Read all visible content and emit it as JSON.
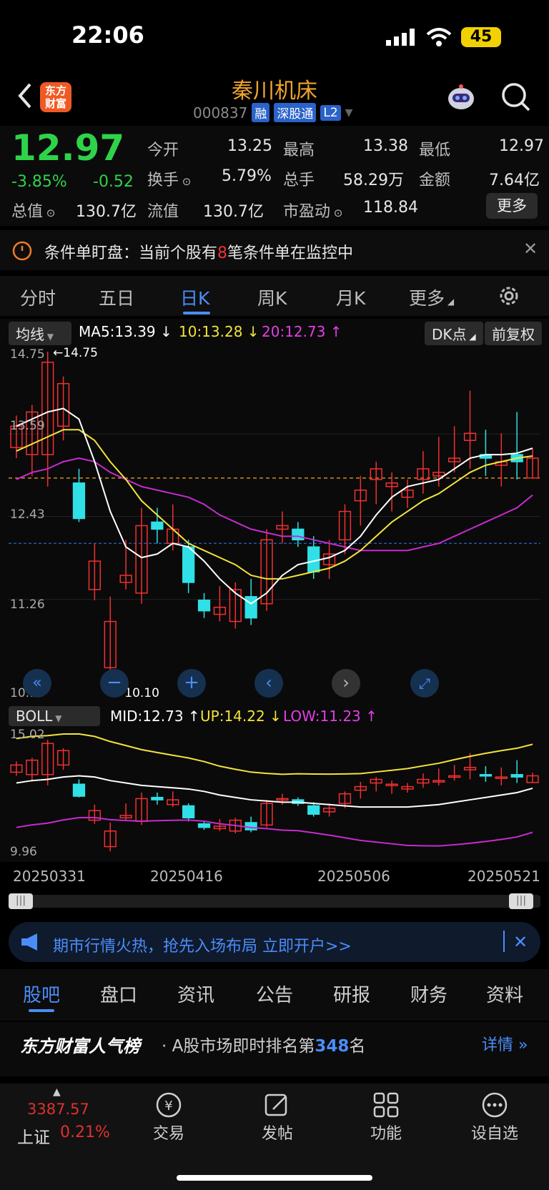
{
  "status": {
    "time": "22:06",
    "battery": "45"
  },
  "header": {
    "logo": "东方\n财富",
    "stock_name": "秦川机床",
    "stock_code": "000837",
    "tags": [
      "融",
      "深股通",
      "L2"
    ]
  },
  "quote": {
    "price": "12.97",
    "change_pct": "-3.85%",
    "change": "-0.52",
    "fields": [
      {
        "label": "今开",
        "value": "13.25"
      },
      {
        "label": "最高",
        "value": "13.38"
      },
      {
        "label": "最低",
        "value": "12.97"
      },
      {
        "label": "换手",
        "value": "5.79%"
      },
      {
        "label": "总手",
        "value": "58.29万"
      },
      {
        "label": "金额",
        "value": "7.64亿"
      },
      {
        "label": "总值",
        "value": "130.7亿"
      },
      {
        "label": "流值",
        "value": "130.7亿"
      },
      {
        "label": "市盈动",
        "value": "118.84"
      }
    ],
    "more_label": "更多"
  },
  "condition_bar": {
    "text_prefix": "条件单盯盘：当前个股有",
    "count": "8",
    "text_suffix": "笔条件单在监控中"
  },
  "period_tabs": [
    "分时",
    "五日",
    "日K",
    "周K",
    "月K",
    "更多"
  ],
  "ma_bar": {
    "selector": "均线",
    "ma5": "MA5:13.39",
    "ma10": "10:13.28",
    "ma20": "20:12.73",
    "dk_label": "DK点",
    "adj_label": "前复权"
  },
  "chart_data": {
    "type": "candlestick",
    "y_labels": [
      "14.75",
      "13.59",
      "12.43",
      "11.26",
      "10.10"
    ],
    "ylim": [
      10.1,
      14.75
    ],
    "high_marker": "14.75",
    "low_marker": "10.10",
    "candles": [
      {
        "o": 13.4,
        "c": 13.7,
        "h": 13.85,
        "l": 13.25
      },
      {
        "o": 13.3,
        "c": 13.9,
        "h": 14.0,
        "l": 13.0
      },
      {
        "o": 13.3,
        "c": 14.6,
        "h": 14.75,
        "l": 12.85
      },
      {
        "o": 13.7,
        "c": 14.3,
        "h": 14.4,
        "l": 13.5
      },
      {
        "o": 12.9,
        "c": 12.4,
        "h": 13.1,
        "l": 12.35
      },
      {
        "o": 11.4,
        "c": 11.8,
        "h": 12.05,
        "l": 11.25
      },
      {
        "o": 10.3,
        "c": 10.95,
        "h": 11.3,
        "l": 10.1
      },
      {
        "o": 11.5,
        "c": 11.6,
        "h": 12.1,
        "l": 11.4
      },
      {
        "o": 11.35,
        "c": 12.3,
        "h": 12.55,
        "l": 11.2
      },
      {
        "o": 12.35,
        "c": 12.25,
        "h": 12.55,
        "l": 12.05
      },
      {
        "o": 12.05,
        "c": 12.25,
        "h": 12.6,
        "l": 11.95
      },
      {
        "o": 12.0,
        "c": 11.5,
        "h": 12.1,
        "l": 11.35
      },
      {
        "o": 11.25,
        "c": 11.1,
        "h": 11.35,
        "l": 11.0
      },
      {
        "o": 11.05,
        "c": 11.15,
        "h": 11.45,
        "l": 10.95
      },
      {
        "o": 10.95,
        "c": 11.4,
        "h": 11.5,
        "l": 10.85
      },
      {
        "o": 11.3,
        "c": 11.0,
        "h": 11.55,
        "l": 10.9
      },
      {
        "o": 11.2,
        "c": 12.1,
        "h": 12.25,
        "l": 11.1
      },
      {
        "o": 12.25,
        "c": 12.3,
        "h": 12.5,
        "l": 12.05
      },
      {
        "o": 12.25,
        "c": 12.1,
        "h": 12.35,
        "l": 12.0
      },
      {
        "o": 12.0,
        "c": 11.65,
        "h": 12.15,
        "l": 11.55
      },
      {
        "o": 11.75,
        "c": 11.9,
        "h": 12.1,
        "l": 11.55
      },
      {
        "o": 12.1,
        "c": 12.5,
        "h": 12.6,
        "l": 11.9
      },
      {
        "o": 12.65,
        "c": 12.8,
        "h": 13.0,
        "l": 12.3
      },
      {
        "o": 12.95,
        "c": 13.1,
        "h": 13.2,
        "l": 12.6
      },
      {
        "o": 12.85,
        "c": 12.9,
        "h": 13.05,
        "l": 12.5
      },
      {
        "o": 12.7,
        "c": 12.8,
        "h": 12.95,
        "l": 12.55
      },
      {
        "o": 12.95,
        "c": 13.1,
        "h": 13.35,
        "l": 12.75
      },
      {
        "o": 13.0,
        "c": 13.05,
        "h": 13.55,
        "l": 12.85
      },
      {
        "o": 13.2,
        "c": 13.25,
        "h": 13.7,
        "l": 13.05
      },
      {
        "o": 13.5,
        "c": 13.6,
        "h": 14.2,
        "l": 13.1
      },
      {
        "o": 13.3,
        "c": 13.25,
        "h": 13.65,
        "l": 13.0
      },
      {
        "o": 13.15,
        "c": 13.2,
        "h": 13.6,
        "l": 12.85
      },
      {
        "o": 13.3,
        "c": 13.2,
        "h": 13.9,
        "l": 12.95
      },
      {
        "o": 12.97,
        "c": 13.25,
        "h": 13.38,
        "l": 12.97
      }
    ],
    "ma5": [
      13.7,
      13.8,
      13.9,
      13.95,
      13.8,
      13.2,
      12.5,
      12.0,
      11.85,
      11.9,
      12.05,
      12.0,
      11.8,
      11.55,
      11.35,
      11.2,
      11.35,
      11.6,
      11.75,
      11.8,
      11.85,
      11.95,
      12.15,
      12.45,
      12.7,
      12.85,
      12.9,
      12.95,
      13.1,
      13.25,
      13.3,
      13.3,
      13.32,
      13.39
    ],
    "ma10": [
      13.35,
      13.45,
      13.55,
      13.65,
      13.65,
      13.5,
      13.2,
      12.95,
      12.65,
      12.45,
      12.25,
      12.05,
      11.95,
      11.85,
      11.75,
      11.6,
      11.55,
      11.55,
      11.6,
      11.65,
      11.7,
      11.8,
      11.95,
      12.15,
      12.35,
      12.5,
      12.65,
      12.75,
      12.9,
      13.05,
      13.15,
      13.2,
      13.25,
      13.28
    ],
    "ma20": [
      12.95,
      13.05,
      13.1,
      13.2,
      13.25,
      13.2,
      13.05,
      12.95,
      12.85,
      12.8,
      12.75,
      12.7,
      12.6,
      12.45,
      12.35,
      12.25,
      12.2,
      12.15,
      12.15,
      12.1,
      12.05,
      12.0,
      11.95,
      11.95,
      11.95,
      11.95,
      12.0,
      12.05,
      12.15,
      12.25,
      12.35,
      12.45,
      12.55,
      12.73
    ],
    "boll": {
      "selector": "BOLL",
      "mid": "MID:12.73",
      "up": "UP:14.22",
      "low": "LOW:11.23",
      "y_labels": [
        "15.02",
        "9.96"
      ]
    },
    "x_labels": [
      "20250331",
      "20250416",
      "20250506",
      "20250521"
    ]
  },
  "banner": {
    "text": "期市行情火热，抢先入场布局 立即开户>>"
  },
  "bottom_tabs": [
    "股吧",
    "盘口",
    "资讯",
    "公告",
    "研报",
    "财务",
    "资料"
  ],
  "rank": {
    "brand": "东方财富人气榜",
    "text_prefix": "· A股市场即时排名第",
    "rank": "348",
    "text_suffix": "名",
    "detail": "详情"
  },
  "bottom_nav": {
    "index_value": "3387.57",
    "index_name": "上证",
    "index_change": "0.21%",
    "items": [
      "交易",
      "发帖",
      "功能",
      "设自选"
    ]
  }
}
